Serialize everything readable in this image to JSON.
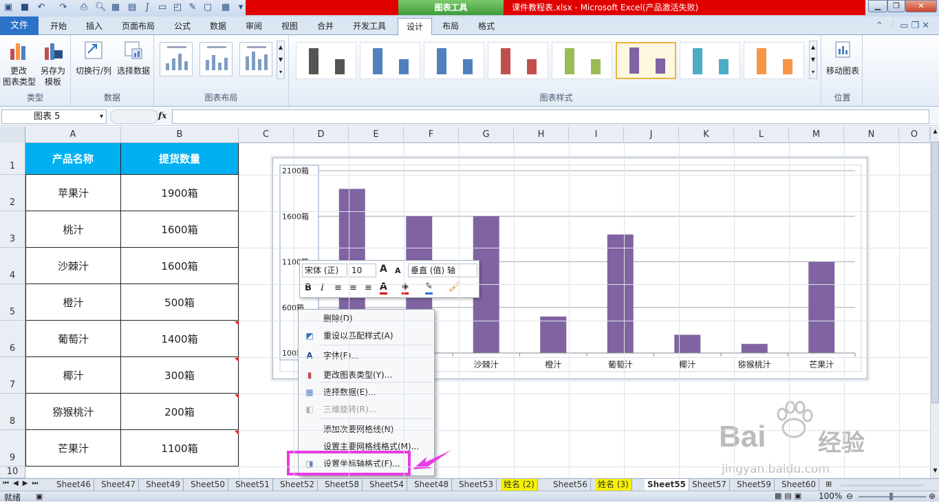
{
  "window": {
    "title": "课件教程表.xlsx - Microsoft Excel(产品激活失败)",
    "context_tab": "图表工具"
  },
  "ribbon_tabs": [
    "文件",
    "开始",
    "插入",
    "页面布局",
    "公式",
    "数据",
    "审阅",
    "视图",
    "合并",
    "开发工具",
    "设计",
    "布局",
    "格式"
  ],
  "ribbon": {
    "type_group": {
      "name": "类型",
      "change_type": "更改\n图表类型",
      "save_template": "另存为\n模板"
    },
    "data_group": {
      "name": "数据",
      "switch": "切换行/列",
      "select_data": "选择数据"
    },
    "layout_group": {
      "name": "图表布局"
    },
    "styles_group": {
      "name": "图表样式",
      "style_colors": [
        "#555555",
        "#4f81bd",
        "#4f81bd",
        "#c0504d",
        "#9bbb59",
        "#8064a2",
        "#4bacc6",
        "#f79646"
      ],
      "selected_index": 5
    },
    "location_group": {
      "name": "位置",
      "move_chart": "移动图表"
    }
  },
  "namebox": {
    "value": "图表 5",
    "fx": "fx"
  },
  "columns": [
    "A",
    "B",
    "C",
    "D",
    "E",
    "F",
    "G",
    "H",
    "I",
    "J",
    "K",
    "L",
    "M",
    "N",
    "O"
  ],
  "rows": [
    "1",
    "2",
    "3",
    "4",
    "5",
    "6",
    "7",
    "8",
    "9",
    "10"
  ],
  "table": {
    "headers": [
      "产品名称",
      "提货数量"
    ],
    "rows": [
      [
        "苹果汁",
        "1900箱"
      ],
      [
        "桃汁",
        "1600箱"
      ],
      [
        "沙棘汁",
        "1600箱"
      ],
      [
        "橙汁",
        "500箱"
      ],
      [
        "葡萄汁",
        "1400箱"
      ],
      [
        "椰汁",
        "300箱"
      ],
      [
        "猕猴桃汁",
        "200箱"
      ],
      [
        "芒果汁",
        "1100箱"
      ]
    ]
  },
  "chart_data": {
    "type": "bar",
    "categories": [
      "苹果汁",
      "桃汁",
      "沙棘汁",
      "橙汁",
      "葡萄汁",
      "椰汁",
      "猕猴桃汁",
      "芒果汁"
    ],
    "values": [
      1900,
      1600,
      1600,
      500,
      1400,
      300,
      200,
      1100
    ],
    "y_ticks": [
      "2100箱",
      "1600箱",
      "1100箱",
      "600箱",
      "100箱"
    ],
    "ylim": [
      100,
      2100
    ],
    "bar_color": "#8064a2",
    "grid": true,
    "xlabel": "",
    "ylabel": ""
  },
  "mini_toolbar": {
    "font": "宋体 (正)",
    "size": "10",
    "grow": "A",
    "shrink": "A",
    "element": "垂直 (值) 轴",
    "bold": "B",
    "italic": "I"
  },
  "context_menu": [
    {
      "label": "删除(D)",
      "icon": "",
      "disabled": false
    },
    {
      "label": "重设以匹配样式(A)",
      "icon": "reset-style-icon",
      "disabled": false
    },
    {
      "label": "字体(F)...",
      "icon": "font-icon",
      "disabled": false
    },
    {
      "label": "更改图表类型(Y)...",
      "icon": "chart-type-icon",
      "disabled": false
    },
    {
      "label": "选择数据(E)...",
      "icon": "select-data-icon",
      "disabled": false
    },
    {
      "label": "三维旋转(R)...",
      "icon": "rotate-3d-icon",
      "disabled": true
    },
    {
      "label": "添加次要网格线(N)",
      "icon": "",
      "disabled": false
    },
    {
      "label": "设置主要网格线格式(M)...",
      "icon": "",
      "disabled": false
    },
    {
      "label": "设置坐标轴格式(F)...",
      "icon": "format-axis-icon",
      "disabled": false
    }
  ],
  "sheet_tabs": [
    "Sheet46",
    "Sheet47",
    "Sheet49",
    "Sheet50",
    "Sheet51",
    "Sheet52",
    "Sheet58",
    "Sheet54",
    "Sheet48",
    "Sheet53",
    "姓名 (2)",
    "Sheet56",
    "姓名 (3)",
    "Sheet55",
    "Sheet57",
    "Sheet59",
    "Sheet60"
  ],
  "status": {
    "ready": "就绪",
    "zoom": "100%"
  },
  "watermark": {
    "brand": "Bai",
    "brand2": "经验",
    "url": "jingyan.baidu.com"
  }
}
